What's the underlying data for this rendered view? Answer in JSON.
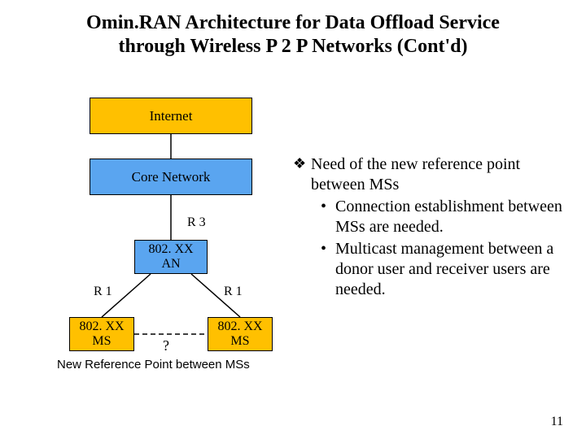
{
  "title_line1": "Omin.RAN Architecture for Data Offload Service",
  "title_line2": "through Wireless P 2 P Networks (Cont'd)",
  "boxes": {
    "internet": "Internet",
    "core": "Core Network",
    "an_line1": "802. XX",
    "an_line2": "AN",
    "ms_line1": "802. XX",
    "ms_line2": "MS"
  },
  "labels": {
    "r3": "R 3",
    "r1": "R 1",
    "q": "?",
    "newref": "New Reference Point between MSs"
  },
  "bullets": {
    "main": "Need of the new reference point between MSs",
    "sub": [
      "Connection establishment between MSs are needed.",
      "Multicast management between a donor user and receiver users are needed."
    ]
  },
  "page": "11"
}
